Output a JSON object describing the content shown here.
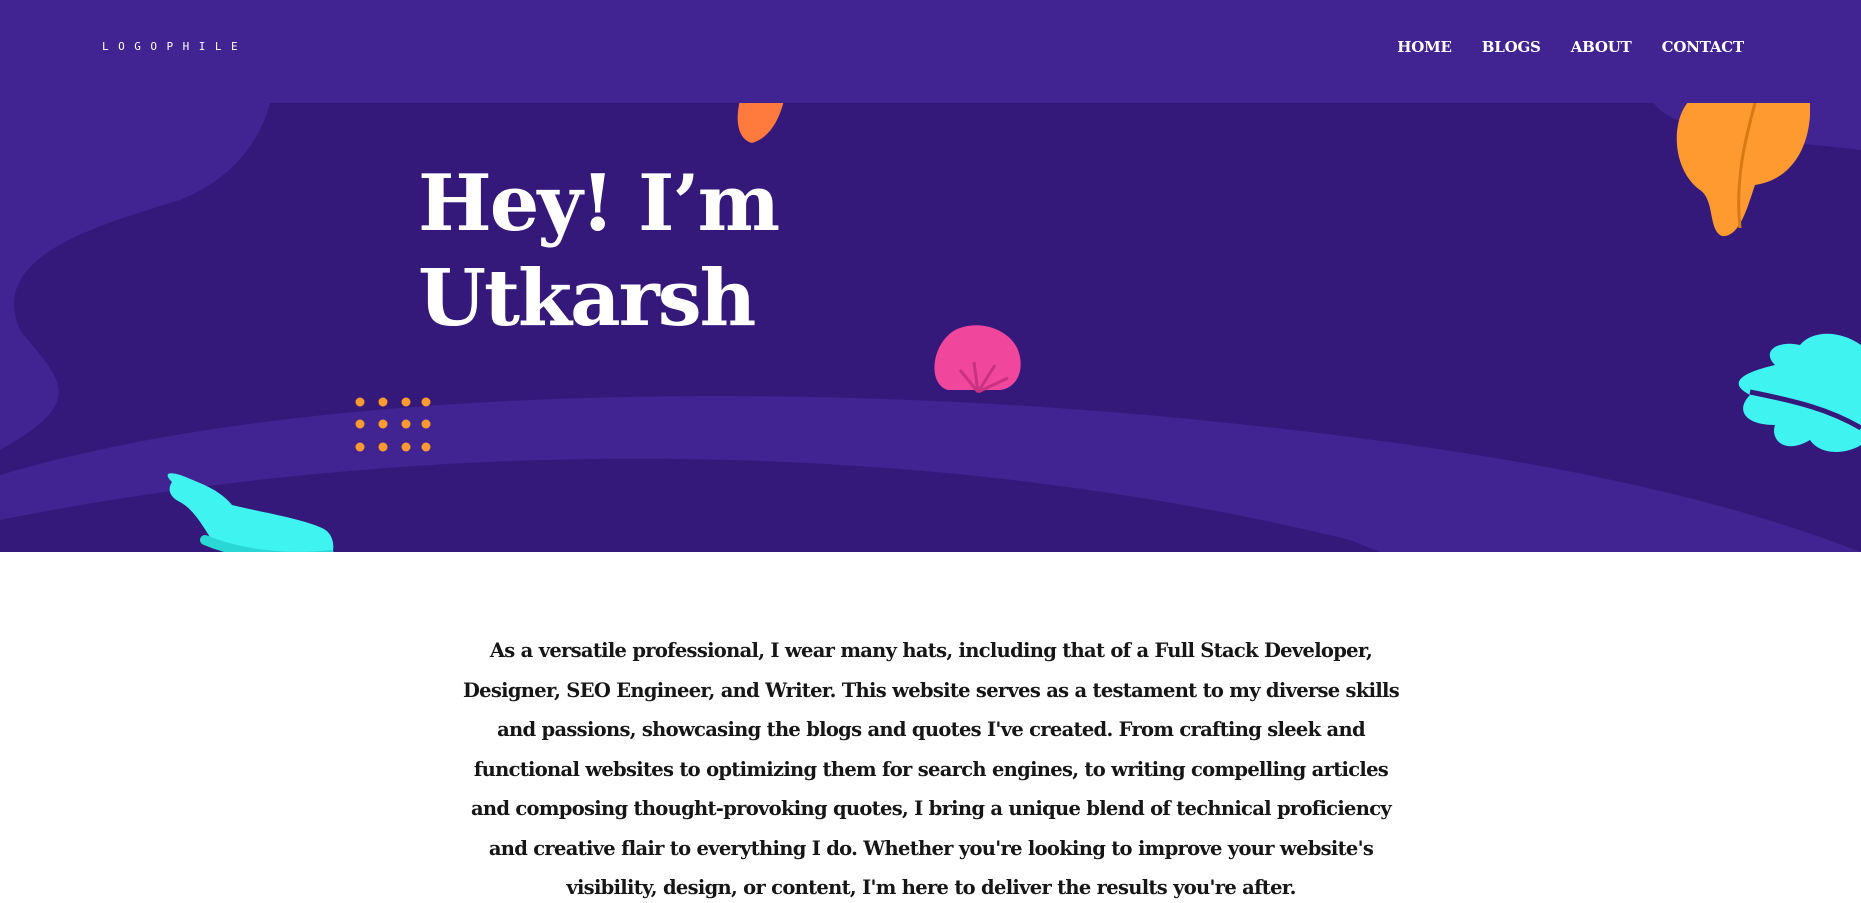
{
  "brand": {
    "logo_text": "LOGOPHILE"
  },
  "nav": {
    "items": [
      {
        "label": "HOME"
      },
      {
        "label": "BLOGS"
      },
      {
        "label": "ABOUT"
      },
      {
        "label": "CONTACT"
      }
    ]
  },
  "hero": {
    "title_line1": "Hey! I’m",
    "title_line2": "Utkarsh"
  },
  "about": {
    "paragraph": "As a versatile professional, I wear many hats, including that of a Full Stack Developer, Designer, SEO Engineer, and Writer. This website serves as a testament to my diverse skills and passions, showcasing the blogs and quotes I've created. From crafting sleek and functional websites to optimizing them for search engines, to writing compelling articles and composing thought-provoking quotes, I bring a unique blend of technical proficiency and creative flair to everything I do. Whether you're looking to improve your website's visibility, design, or content, I'm here to deliver the results you're after."
  },
  "colors": {
    "header_bg": "#412391",
    "hero_bg": "#34197b",
    "accent_orange": "#ff9a30",
    "accent_cyan": "#3ff3f0",
    "accent_pink": "#f0479c",
    "text_dark": "#161616"
  },
  "decor": {
    "icons": [
      "orange-leaf-top-icon",
      "orange-leaf-right-icon",
      "pink-shell-icon",
      "cyan-leaf-icon",
      "cyan-blob-icon",
      "orange-dot-grid-icon"
    ]
  }
}
